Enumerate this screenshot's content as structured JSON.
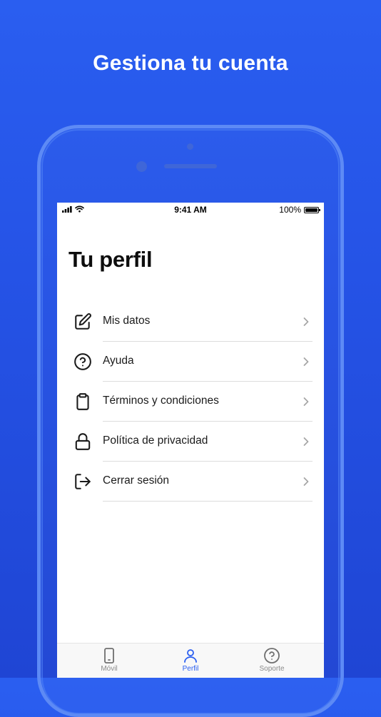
{
  "headline": "Gestiona tu cuenta",
  "status_bar": {
    "time": "9:41 AM",
    "battery": "100%"
  },
  "page": {
    "title": "Tu perfil"
  },
  "menu": {
    "items": [
      {
        "label": "Mis datos",
        "icon": "edit-icon"
      },
      {
        "label": "Ayuda",
        "icon": "help-circle-icon"
      },
      {
        "label": "Términos y condiciones",
        "icon": "clipboard-icon"
      },
      {
        "label": "Política de privacidad",
        "icon": "lock-icon"
      },
      {
        "label": "Cerrar sesión",
        "icon": "logout-icon"
      }
    ]
  },
  "tabbar": {
    "tabs": [
      {
        "label": "Móvil",
        "icon": "phone-icon",
        "active": false
      },
      {
        "label": "Perfil",
        "icon": "user-icon",
        "active": true
      },
      {
        "label": "Soporte",
        "icon": "help-circle-icon",
        "active": false
      }
    ]
  },
  "colors": {
    "background": "#2553e6",
    "accent": "#2a5ef0",
    "device_frame": "#5d8af5"
  }
}
